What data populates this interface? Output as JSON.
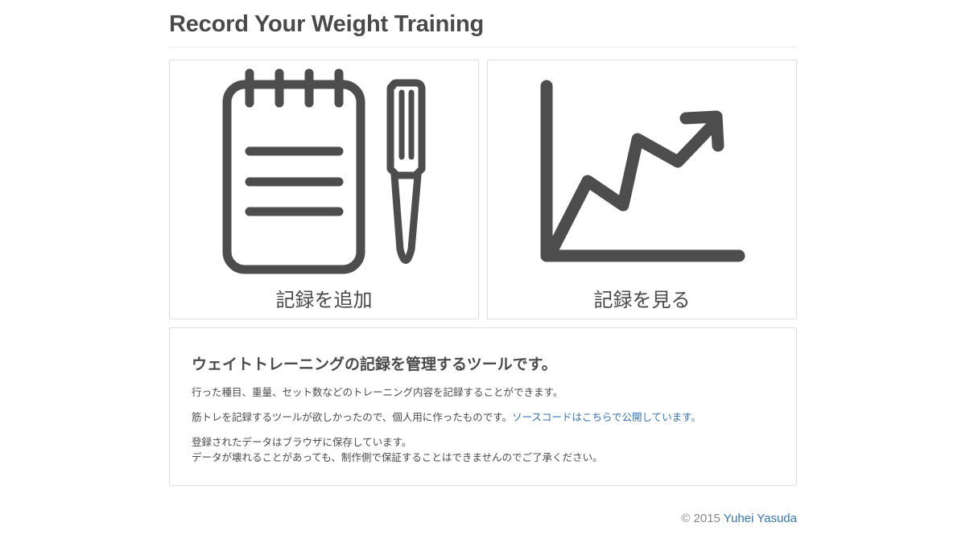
{
  "header": {
    "title": "Record Your Weight Training"
  },
  "cards": {
    "add": {
      "label": "記録を追加",
      "icon": "notepad-pen-icon"
    },
    "view": {
      "label": "記録を見る",
      "icon": "line-chart-icon"
    }
  },
  "info": {
    "heading": "ウェイトトレーニングの記録を管理するツールです。",
    "paragraph1": "行った種目、重量、セット数などのトレーニング内容を記録することができます。",
    "paragraph2_text": "筋トレを記録するツールが欲しかったので、個人用に作ったものです。",
    "paragraph2_link": "ソースコードはこちらで公開しています。",
    "paragraph3_line1": "登録されたデータはブラウザに保存しています。",
    "paragraph3_line2": "データが壊れることがあっても、制作側で保証することはできませんのでご了承ください。"
  },
  "footer": {
    "copyright": "© 2015",
    "author": "Yuhei Yasuda"
  },
  "colors": {
    "text": "#4a4a4a",
    "link": "#3a73b5",
    "border": "#dddddd",
    "icon": "#4d4d4d"
  }
}
